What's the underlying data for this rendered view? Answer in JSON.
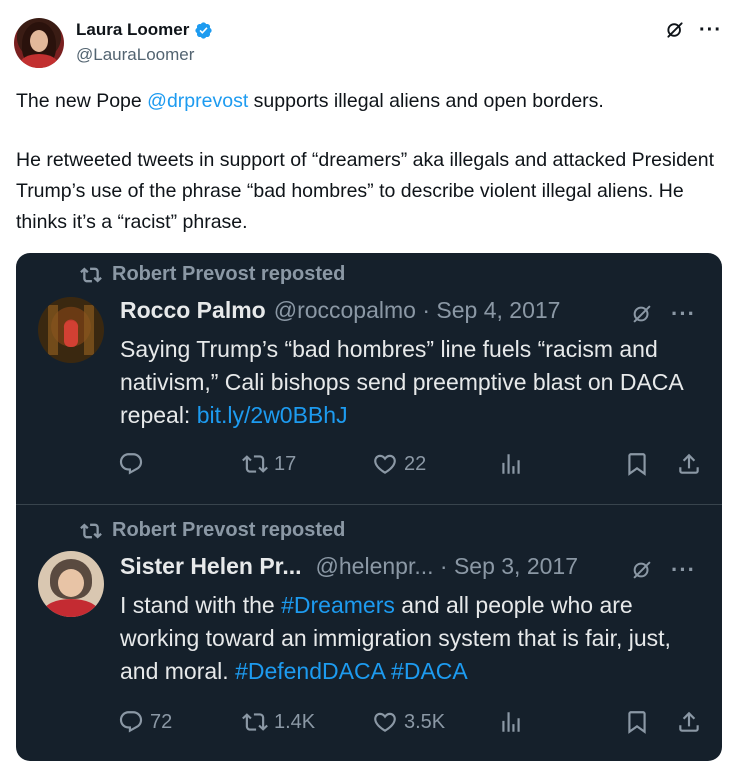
{
  "author": {
    "name": "Laura Loomer",
    "handle": "@LauraLoomer",
    "verified": true,
    "accent_color": "#1d9bf0"
  },
  "post": {
    "p1_pre": "The new Pope ",
    "p1_mention": "@drprevost",
    "p1_post": " supports illegal aliens and open borders.",
    "p2": "He retweeted tweets in support of “dreamers” aka illegals and attacked President Trump’s use of the phrase “bad hombres” to describe violent illegal aliens. He thinks it’s a “racist” phrase."
  },
  "embedded": {
    "theme_bg": "#15202b",
    "tweets": [
      {
        "repost_label": "Robert Prevost reposted",
        "name": "Rocco Palmo",
        "meta": "@roccopalmo · Sep 4, 2017",
        "text": "Saying Trump’s “bad hombres” line fuels “racism and nativism,” Cali bishops send preemptive blast on DACA repeal: ",
        "link": "bit.ly/2w0BBhJ",
        "replies": "",
        "reposts": "17",
        "likes": "22"
      },
      {
        "repost_label": "Robert Prevost reposted",
        "name": "Sister Helen Pr...",
        "meta": "@helenpr... · Sep 3, 2017",
        "text_a": "I stand with the ",
        "tag1": "#Dreamers",
        "text_b": " and all people who are working toward an immigration system that is fair, just, and moral. ",
        "tag2": "#DefendDACA",
        "tag3": "#DACA",
        "replies": "72",
        "reposts": "1.4K",
        "likes": "3.5K"
      }
    ]
  },
  "icons": [
    "verified-badge-icon",
    "grok-icon",
    "more-icon",
    "repost-icon",
    "reply-icon",
    "like-icon",
    "views-icon",
    "bookmark-icon",
    "share-icon"
  ]
}
